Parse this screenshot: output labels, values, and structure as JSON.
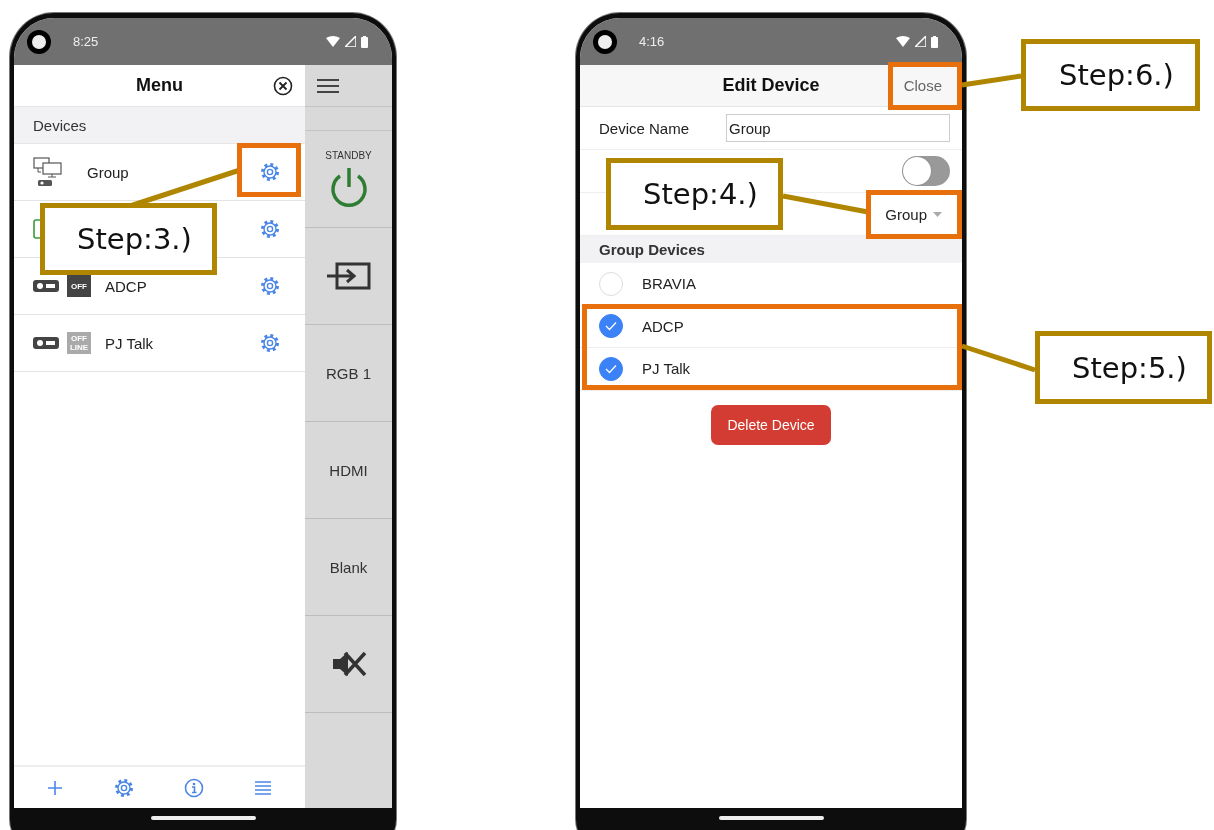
{
  "menu_phone": {
    "time": "8:25",
    "title": "Menu",
    "section": "Devices",
    "devices": [
      {
        "kind": "group",
        "name": "Group"
      },
      {
        "kind": "display"
      },
      {
        "kind": "projector",
        "color": "#444444",
        "badge": "OFF",
        "name": "ADCP"
      },
      {
        "kind": "projector",
        "color": "#aaaaaa",
        "badge": "OFF LINE",
        "name": "PJ Talk"
      }
    ],
    "side_panel": [
      {
        "kind": "power",
        "label": "STANDBY"
      },
      {
        "kind": "input"
      },
      {
        "kind": "text",
        "label": "RGB 1"
      },
      {
        "kind": "text",
        "label": "HDMI"
      },
      {
        "kind": "text",
        "label": "Blank"
      },
      {
        "kind": "mute"
      },
      {
        "kind": "empty"
      }
    ],
    "toolbar": [
      {
        "kind": "add"
      },
      {
        "kind": "settings"
      },
      {
        "kind": "info"
      },
      {
        "kind": "list"
      }
    ]
  },
  "edit_phone": {
    "time": "4:16",
    "title": "Edit Device",
    "close": "Close",
    "fields": [
      {
        "kind": "text",
        "label": "Device Name",
        "value": "Group"
      },
      {
        "kind": "toggle",
        "on": false
      },
      {
        "kind": "dropdown",
        "value": "Group"
      }
    ],
    "section": "Group Devices",
    "members": [
      {
        "name": "BRAVIA",
        "checked": false
      },
      {
        "name": "ADCP",
        "checked": true
      },
      {
        "name": "PJ Talk",
        "checked": true
      }
    ],
    "delete": "Delete Device"
  },
  "annotations": [
    {
      "label": "Step:3.)"
    },
    {
      "label": "Step:4.)"
    },
    {
      "label": "Step:6.)"
    },
    {
      "label": "Step:5.)"
    }
  ]
}
